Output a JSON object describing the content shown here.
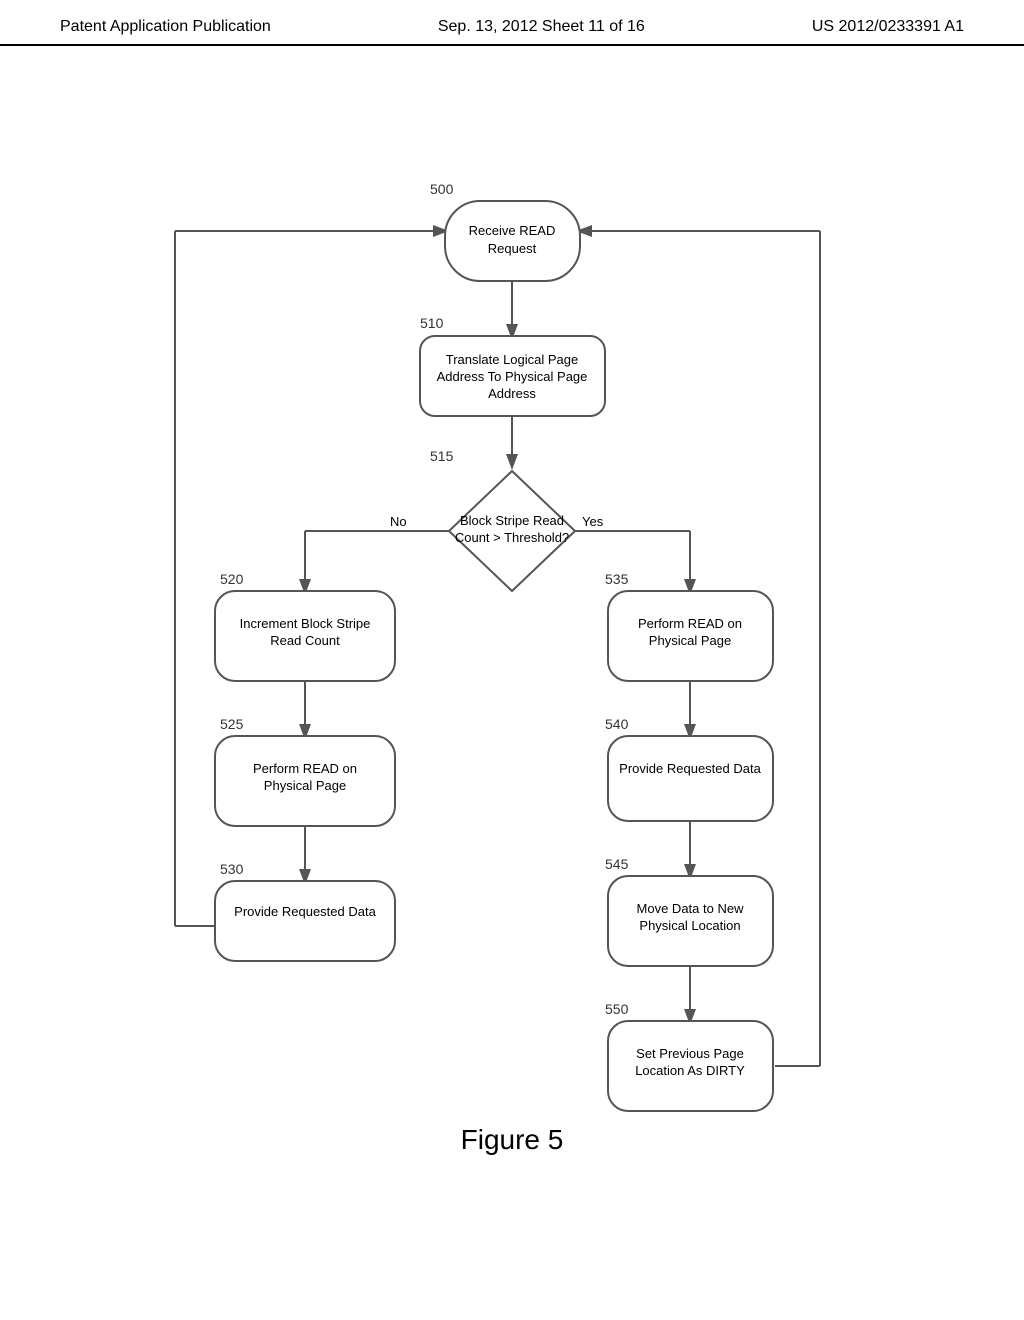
{
  "header": {
    "left": "Patent Application Publication",
    "center": "Sep. 13, 2012   Sheet 11 of 16",
    "right": "US 2012/0233391 A1"
  },
  "figure": {
    "caption": "Figure 5"
  },
  "nodes": {
    "n500_label": "500",
    "n500_text": "Receive READ\nRequest",
    "n510_label": "510",
    "n510_text": "Translate Logical Page\nAddress To Physical Page\nAddress",
    "n515_label": "515",
    "n515_text": "Block Stripe Read\nCount > Threshold?",
    "n515_no": "No",
    "n515_yes": "Yes",
    "n520_label": "520",
    "n520_text": "Increment Block Stripe\nRead Count",
    "n525_label": "525",
    "n525_text": "Perform READ on\nPhysical Page",
    "n530_label": "530",
    "n530_text": "Provide Requested Data",
    "n535_label": "535",
    "n535_text": "Perform READ on\nPhysical Page",
    "n540_label": "540",
    "n540_text": "Provide Requested Data",
    "n545_label": "545",
    "n545_text": "Move Data to New\nPhysical Location",
    "n550_label": "550",
    "n550_text": "Set Previous Page\nLocation As DIRTY"
  }
}
